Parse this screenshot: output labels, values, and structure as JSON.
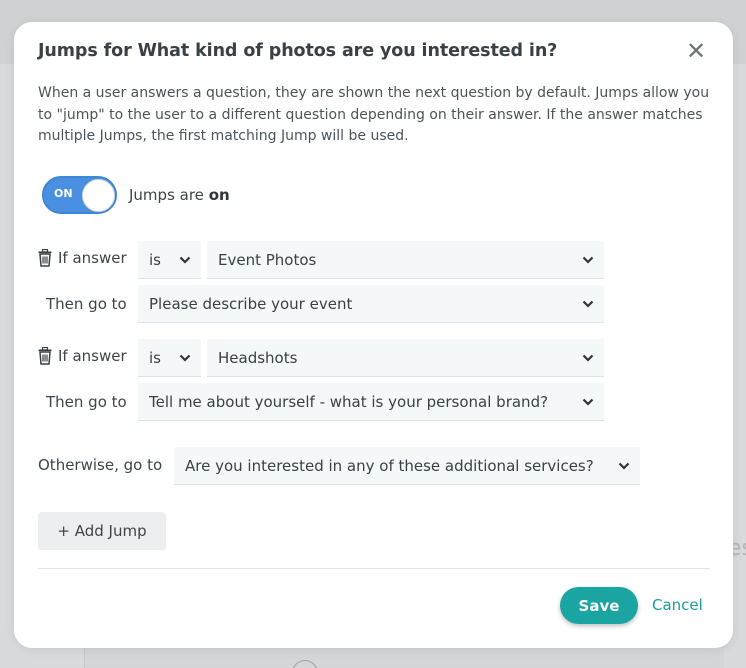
{
  "modal": {
    "title": "Jumps for What kind of photos are you interested in?",
    "close_label": "✕",
    "description": "When a user answers a question, they are shown the next question by default. Jumps allow you to \"jump\" to the user to a different question depending on their answer. If the answer matches multiple Jumps, the first matching Jump will be used.",
    "toggle": {
      "switch_text": "ON",
      "label_prefix": "Jumps are ",
      "label_state": "on"
    },
    "jumps": [
      {
        "if_label": "If answer",
        "operator": "is",
        "answer": "Event Photos",
        "then_label": "Then go to",
        "target": "Please describe your event"
      },
      {
        "if_label": "If answer",
        "operator": "is",
        "answer": "Headshots",
        "then_label": "Then go to",
        "target": "Tell me about yourself - what is your personal brand?"
      }
    ],
    "otherwise": {
      "label": "Otherwise, go to",
      "target": "Are you interested in any of these additional services?"
    },
    "add_jump_label": "+ Add Jump",
    "save_label": "Save",
    "cancel_label": "Cancel"
  },
  "colors": {
    "accent": "#1aa5a2",
    "toggle": "#4a90e2",
    "field_bg": "#f4f8f9"
  },
  "icons": [
    "trash-icon",
    "chevron-down-icon",
    "close-icon"
  ]
}
